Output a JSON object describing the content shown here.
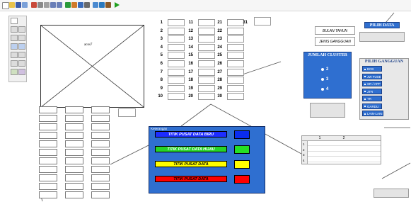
{
  "canvas_placeholder": "acos7",
  "number_labels": [
    "1",
    "2",
    "3",
    "4",
    "5",
    "6",
    "7",
    "8",
    "9",
    "10",
    "11",
    "12",
    "13",
    "14",
    "15",
    "16",
    "17",
    "18",
    "19",
    "20",
    "21",
    "22",
    "23",
    "24",
    "25",
    "26",
    "27",
    "28",
    "29",
    "30",
    "31"
  ],
  "labels": {
    "pilih_data": "PILIH DATA",
    "bulan_tahun": "BULAN TAHUN",
    "jenis_gangguan": "JENIS GANGGUAN",
    "jumlah_cluster": "JUMLAH CLUSTER",
    "pilih_gangguan": "PILIH GANGGUAN",
    "keterangan": "Keterangan"
  },
  "cluster_options": [
    "2",
    "3",
    "4"
  ],
  "gangguan_options": [
    "BCB",
    "JW FUSE",
    "SR / APP",
    "JTR",
    "TR",
    "GARDU",
    "LAIN-LAIN"
  ],
  "legend": [
    {
      "label": "TITIK PUSAT DATA BIRU",
      "bg": "#1d2cff",
      "fg": "#ffffff",
      "color": "#0a2cf0"
    },
    {
      "label": "TITIK PUSAT DATA HIJAU",
      "bg": "#27d327",
      "fg": "#ffffff",
      "color": "#25e025"
    },
    {
      "label": "TITIK PUSAT DATA",
      "bg": "#ffff00",
      "fg": "#000000",
      "color": "#ffff00"
    },
    {
      "label": "TITIK PUSAT DATA",
      "bg": "#ff0000",
      "fg": "#000000",
      "color": "#ff0000"
    }
  ],
  "table": {
    "columns": [
      "1",
      "2"
    ],
    "rows": [
      "1",
      "2",
      "3",
      "4"
    ]
  }
}
